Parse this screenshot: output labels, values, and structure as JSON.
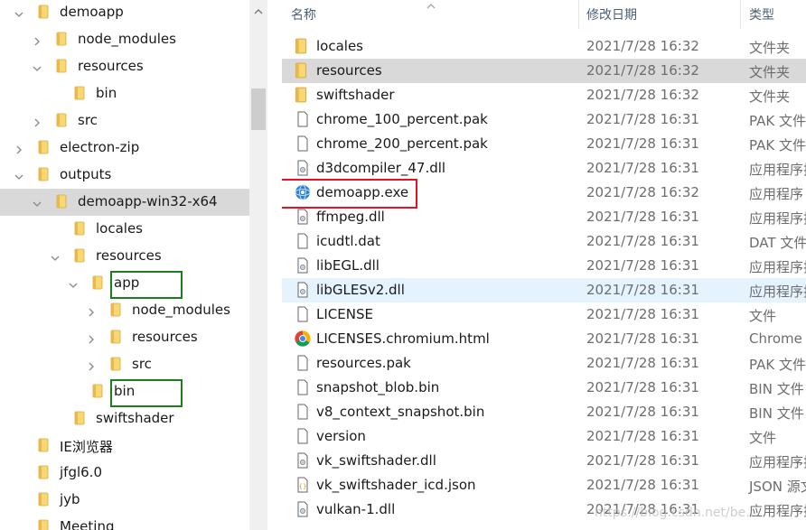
{
  "tree": {
    "items": [
      {
        "label": "demoapp",
        "state": "expanded"
      },
      {
        "label": "node_modules",
        "state": "collapsed"
      },
      {
        "label": "resources",
        "state": "expanded"
      },
      {
        "label": "bin",
        "state": "leaf"
      },
      {
        "label": "src",
        "state": "collapsed"
      },
      {
        "label": "electron-zip",
        "state": "collapsed"
      },
      {
        "label": "outputs",
        "state": "expanded"
      },
      {
        "label": "demoapp-win32-x64",
        "state": "expanded",
        "selected": true
      },
      {
        "label": "locales",
        "state": "leaf"
      },
      {
        "label": "resources",
        "state": "expanded"
      },
      {
        "label": "app",
        "state": "expanded",
        "highlight": "green"
      },
      {
        "label": "node_modules",
        "state": "collapsed"
      },
      {
        "label": "resources",
        "state": "collapsed"
      },
      {
        "label": "src",
        "state": "collapsed"
      },
      {
        "label": "bin",
        "state": "leaf",
        "highlight": "green"
      },
      {
        "label": "swiftshader",
        "state": "leaf"
      },
      {
        "label": "IE浏览器",
        "state": "leaf"
      },
      {
        "label": "jfgl6.0",
        "state": "leaf"
      },
      {
        "label": "jyb",
        "state": "leaf"
      },
      {
        "label": "Meeting",
        "state": "leaf"
      }
    ]
  },
  "list": {
    "headers": {
      "name": "名称",
      "date": "修改日期",
      "type": "类型"
    },
    "files": [
      {
        "name": "locales",
        "date": "2021/7/28 16:32",
        "type": "文件夹",
        "icon": "folder"
      },
      {
        "name": "resources",
        "date": "2021/7/28 16:32",
        "type": "文件夹",
        "icon": "folder",
        "state": "selected"
      },
      {
        "name": "swiftshader",
        "date": "2021/7/28 16:32",
        "type": "文件夹",
        "icon": "folder"
      },
      {
        "name": "chrome_100_percent.pak",
        "date": "2021/7/28 16:31",
        "type": "PAK 文件",
        "icon": "file"
      },
      {
        "name": "chrome_200_percent.pak",
        "date": "2021/7/28 16:31",
        "type": "PAK 文件",
        "icon": "file"
      },
      {
        "name": "d3dcompiler_47.dll",
        "date": "2021/7/28 16:31",
        "type": "应用程序扩",
        "icon": "dll"
      },
      {
        "name": "demoapp.exe",
        "date": "2021/7/28 16:32",
        "type": "应用程序",
        "icon": "exe",
        "highlight": "red"
      },
      {
        "name": "ffmpeg.dll",
        "date": "2021/7/28 16:31",
        "type": "应用程序扩",
        "icon": "dll"
      },
      {
        "name": "icudtl.dat",
        "date": "2021/7/28 16:31",
        "type": "DAT 文件",
        "icon": "file"
      },
      {
        "name": "libEGL.dll",
        "date": "2021/7/28 16:31",
        "type": "应用程序扩",
        "icon": "dll"
      },
      {
        "name": "libGLESv2.dll",
        "date": "2021/7/28 16:31",
        "type": "应用程序扩",
        "icon": "dll",
        "state": "hover"
      },
      {
        "name": "LICENSE",
        "date": "2021/7/28 16:31",
        "type": "文件",
        "icon": "file"
      },
      {
        "name": "LICENSES.chromium.html",
        "date": "2021/7/28 16:31",
        "type": "Chrome",
        "icon": "chrome"
      },
      {
        "name": "resources.pak",
        "date": "2021/7/28 16:31",
        "type": "PAK 文件",
        "icon": "file"
      },
      {
        "name": "snapshot_blob.bin",
        "date": "2021/7/28 16:31",
        "type": "BIN 文件",
        "icon": "file"
      },
      {
        "name": "v8_context_snapshot.bin",
        "date": "2021/7/28 16:31",
        "type": "BIN 文件",
        "icon": "file"
      },
      {
        "name": "version",
        "date": "2021/7/28 16:31",
        "type": "文件",
        "icon": "file"
      },
      {
        "name": "vk_swiftshader.dll",
        "date": "2021/7/28 16:31",
        "type": "应用程序扩",
        "icon": "dll"
      },
      {
        "name": "vk_swiftshader_icd.json",
        "date": "2021/7/28 16:31",
        "type": "JSON 源文",
        "icon": "json"
      },
      {
        "name": "vulkan-1.dll",
        "date": "2021/7/28 16:31",
        "type": "应用程序扩",
        "icon": "dll"
      }
    ]
  },
  "watermark": "https://blog.csdn.net/be...",
  "colors": {
    "selected": "#d9d9d9",
    "hover": "#e5f3ff",
    "folder": "#f8d775",
    "red_box": "#e81123",
    "green_box": "#1a7f1a"
  }
}
